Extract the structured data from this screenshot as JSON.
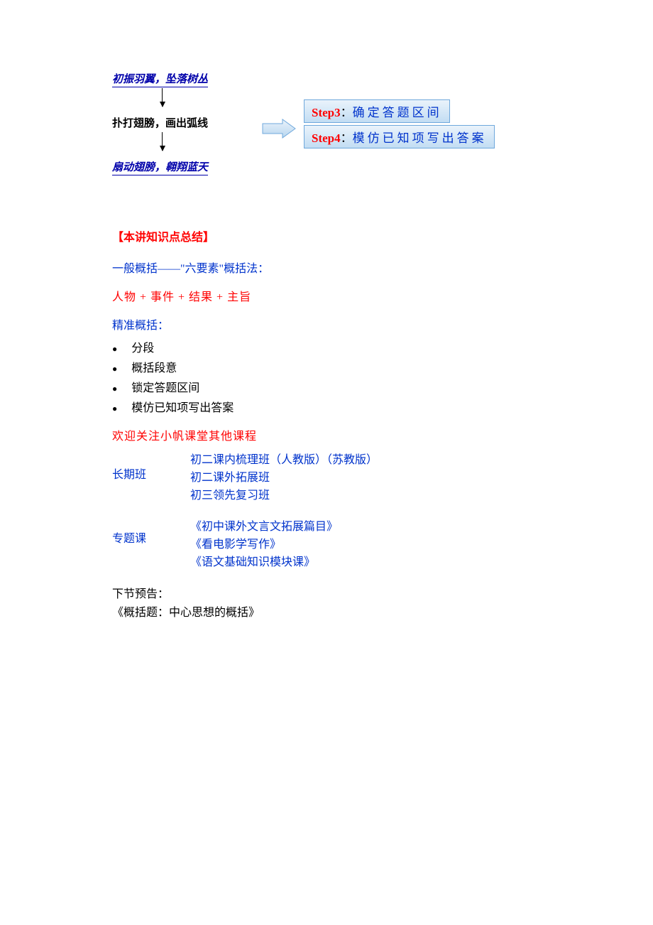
{
  "diagram": {
    "line1": "初振羽翼，坠落树丛",
    "line2": "扑打翅膀，画出弧线",
    "line3": "扇动翅膀，翱翔蓝天",
    "step3_label": "Step3",
    "step3_text": "确定答题区间",
    "step4_label": "Step4",
    "step4_text": "模仿已知项写出答案"
  },
  "summary_title": "【本讲知识点总结】",
  "general_method": "一般概括——\"六要素\"概括法：",
  "formula": "人物    +    事件    +     结果    +   主旨",
  "precise_title": "精准概括：",
  "precise_steps": [
    "分段",
    "概括段意",
    "锁定答题区间",
    "模仿已知项写出答案"
  ],
  "welcome": "欢迎关注小帆课堂其他课程",
  "long_term_label": "长期班",
  "long_term_items": [
    "初二课内梳理班（人教版）（苏教版）",
    "初二课外拓展班",
    "初三领先复习班"
  ],
  "topic_label": "专题课",
  "topic_items": [
    "《初中课外文言文拓展篇目》",
    "《看电影学写作》",
    "《语文基础知识模块课》"
  ],
  "next_label": "下节预告：",
  "next_content": "《概括题：中心思想的概括》"
}
